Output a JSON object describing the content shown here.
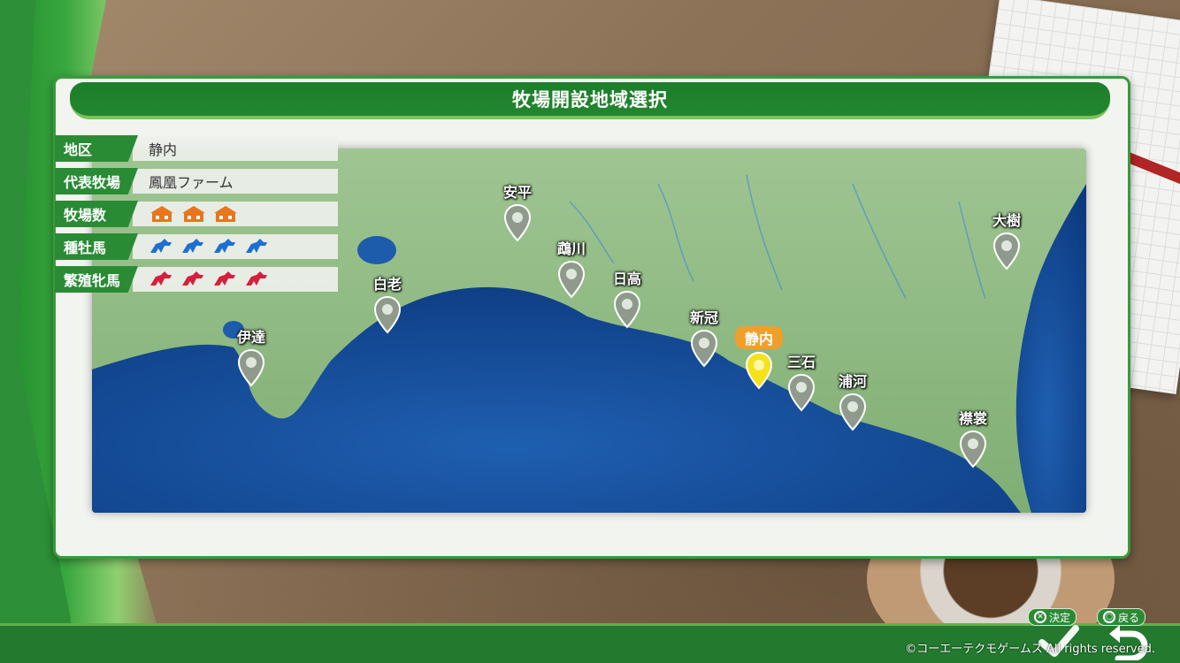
{
  "title": "牧場開設地域選択",
  "info": {
    "rows": [
      {
        "label": "地区",
        "value": "静内"
      },
      {
        "label": "代表牧場",
        "value": "鳳凰ファーム"
      },
      {
        "label": "牧場数",
        "count": 3,
        "icon": "farm-house-icon",
        "color": "#e8761a"
      },
      {
        "label": "種牡馬",
        "count": 4,
        "icon": "stallion-horse-icon",
        "color": "#1f6fd1"
      },
      {
        "label": "繁殖牝馬",
        "count": 4,
        "icon": "mare-horse-icon",
        "color": "#d61f3a"
      }
    ]
  },
  "map": {
    "regions": [
      {
        "name": "伊達",
        "selected": false
      },
      {
        "name": "白老",
        "selected": false
      },
      {
        "name": "安平",
        "selected": false
      },
      {
        "name": "鵡川",
        "selected": false
      },
      {
        "name": "日高",
        "selected": false
      },
      {
        "name": "新冠",
        "selected": false
      },
      {
        "name": "静内",
        "selected": true
      },
      {
        "name": "三石",
        "selected": false
      },
      {
        "name": "浦河",
        "selected": false
      },
      {
        "name": "襟裳",
        "selected": false
      },
      {
        "name": "大樹",
        "selected": false
      }
    ]
  },
  "controls": {
    "confirm_glyph": "✕",
    "confirm_label": "決定",
    "back_glyph": "○",
    "back_label": "戻る"
  },
  "copyright": "©コーエーテクモゲームス All rights reserved."
}
